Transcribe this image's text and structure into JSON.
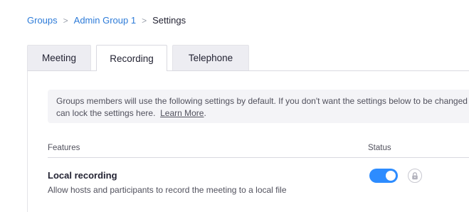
{
  "breadcrumb": {
    "items": [
      "Groups",
      "Admin Group 1",
      "Settings"
    ],
    "separator": ">"
  },
  "tabs": [
    {
      "label": "Meeting",
      "active": false
    },
    {
      "label": "Recording",
      "active": true
    },
    {
      "label": "Telephone",
      "active": false
    }
  ],
  "notice": {
    "text": "Groups members will use the following settings by default. If you don't want the settings below to be changed by group members, you",
    "text2": "can lock the settings here.",
    "link": "Learn More",
    "end": "."
  },
  "table": {
    "col_features": "Features",
    "col_status": "Status"
  },
  "settings": [
    {
      "title": "Local recording",
      "description": "Allow hosts and participants to record the meeting to a local file",
      "enabled": true,
      "icon": "lock-icon"
    }
  ],
  "colors": {
    "accent": "#2d8cff",
    "link": "#2d7bd8"
  }
}
